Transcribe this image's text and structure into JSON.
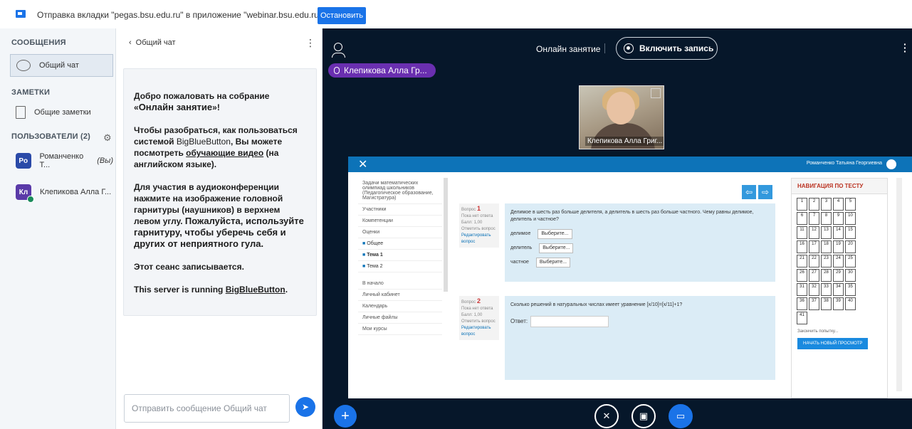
{
  "topbar": {
    "message": "Отправка вкладки \"pegas.bsu.edu.ru\" в приложение \"webinar.bsu.edu.ru\"...",
    "stop_label": "Остановить"
  },
  "sidebar": {
    "messages_title": "СООБЩЕНИЯ",
    "public_chat": "Общий чат",
    "notes_title": "ЗАМЕТКИ",
    "shared_notes": "Общие заметки",
    "users_title": "ПОЛЬЗОВАТЕЛИ (2)",
    "users": [
      {
        "initials": "Po",
        "name": "Романченко Т...",
        "suffix": "(Вы)"
      },
      {
        "initials": "Кл",
        "name": "Клепикова Алла Г..."
      }
    ]
  },
  "chat": {
    "header": "Общий чат",
    "welcome_intro": "Добро пожаловать на собрание «",
    "welcome_session": "Онлайн занятие",
    "welcome_end": "»!",
    "p2_a": "Чтобы разобраться, как пользоваться системой ",
    "p2_bbb": "BigBlueButton",
    "p2_b": ", Вы можете посмотреть ",
    "p2_link": "обучающие видео",
    "p2_c": " (на английском языке).",
    "p3_a": "Для участия в аудиоконференции нажмите на изображение головной гарнитуры (наушников) в верхнем левом углу. ",
    "p3_b": "Пожалуйста, используйте гарнитуру, чтобы уберечь себя и других от неприятного гула.",
    "p4": "Этот сеанс записывается.",
    "p5_a": "This server is running ",
    "p5_link": "BigBlueButton",
    "p5_b": ".",
    "input_placeholder": "Отправить сообщение Общий чат"
  },
  "main": {
    "session_title": "Онлайн занятие",
    "record_label": "Включить запись",
    "talker": "Клепикова Алла Гр...",
    "webcam_name": "Клепикова Алла Григ..."
  },
  "share": {
    "user": "Романченко Татьяна Георгиевна",
    "side_items": [
      "Задачи математических олимпиад школьников (Педагогическое образование, Магистратура)",
      "Участники",
      "Компетенции",
      "Оценки"
    ],
    "folders": [
      "Общее",
      "Тема 1",
      "Тема 2"
    ],
    "links": [
      "В начало",
      "Личный кабинет",
      "Календарь",
      "Личные файлы",
      "Мои курсы"
    ],
    "q1": {
      "label": "Вопрос",
      "num": "1",
      "status": "Пока нет ответа",
      "score": "Балл: 1,00",
      "flag": "Отметить вопрос",
      "edit": "Редактировать вопрос",
      "text": "Делимое в шесть раз больше делителя, а делитель в шесть раз больше частного. Чему равны делимое, делитель и частное?",
      "rows": [
        "делимое",
        "делитель",
        "частное"
      ],
      "select": "Выберите..."
    },
    "q2": {
      "label": "Вопрос",
      "num": "2",
      "status": "Пока нет ответа",
      "score": "Балл: 1,00",
      "flag": "Отметить вопрос",
      "edit": "Редактировать вопрос",
      "text": "Сколько решений в натуральных числах имеет уравнение [x/10]=[x/11]+1?",
      "answer": "Ответ:"
    },
    "nav_title": "НАВИГАЦИЯ ПО ТЕСТУ",
    "nav_numbers": [
      "1",
      "2",
      "3",
      "4",
      "5",
      "6",
      "7",
      "8",
      "9",
      "10",
      "11",
      "12",
      "13",
      "14",
      "15",
      "16",
      "17",
      "18",
      "19",
      "20",
      "21",
      "22",
      "23",
      "24",
      "25",
      "26",
      "27",
      "28",
      "29",
      "30",
      "31",
      "32",
      "33",
      "34",
      "35",
      "36",
      "37",
      "38",
      "39",
      "40",
      "41"
    ],
    "finish": "Закончить попытку...",
    "new_preview": "НАЧАТЬ НОВЫЙ ПРОСМОТР"
  },
  "icons": {
    "brand_color": "#1a73e8",
    "talker_color": "#6a2fb0",
    "background": "#06172a"
  }
}
